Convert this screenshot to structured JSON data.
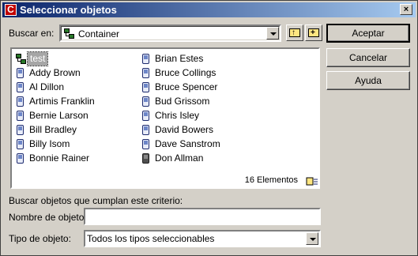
{
  "window": {
    "title": "Seleccionar objetos",
    "close": "×",
    "app_icon": "C"
  },
  "search": {
    "label": "Buscar en:",
    "combo_value": "Container"
  },
  "buttons": {
    "accept": "Aceptar",
    "cancel": "Cancelar",
    "help": "Ayuda"
  },
  "list": {
    "items": [
      {
        "label": "test",
        "icon": "tree-icon",
        "selected": true
      },
      {
        "label": "Addy Brown",
        "icon": "phone-icon"
      },
      {
        "label": "Al Dillon",
        "icon": "phone-icon"
      },
      {
        "label": "Artimis Franklin",
        "icon": "phone-icon"
      },
      {
        "label": "Bernie Larson",
        "icon": "phone-icon"
      },
      {
        "label": "Bill Bradley",
        "icon": "phone-icon"
      },
      {
        "label": "Billy Isom",
        "icon": "phone-icon"
      },
      {
        "label": "Bonnie Rainer",
        "icon": "phone-icon"
      },
      {
        "label": "Brian Estes",
        "icon": "phone-icon"
      },
      {
        "label": "Bruce Collings",
        "icon": "phone-icon"
      },
      {
        "label": "Bruce Spencer",
        "icon": "phone-icon"
      },
      {
        "label": "Bud Grissom",
        "icon": "phone-icon"
      },
      {
        "label": "Chris Isley",
        "icon": "phone-icon"
      },
      {
        "label": "David Bowers",
        "icon": "phone-icon"
      },
      {
        "label": "Dave Sanstrom",
        "icon": "phone-icon"
      },
      {
        "label": "Don Allman",
        "icon": "phone-dark-icon"
      }
    ],
    "count": "16 Elementos"
  },
  "criteria": {
    "heading": "Buscar objetos que cumplan este criterio:",
    "name_label": "Nombre de objeto:",
    "name_value": "",
    "type_label": "Tipo de objeto:",
    "type_value": "Todos los tipos seleccionables"
  }
}
